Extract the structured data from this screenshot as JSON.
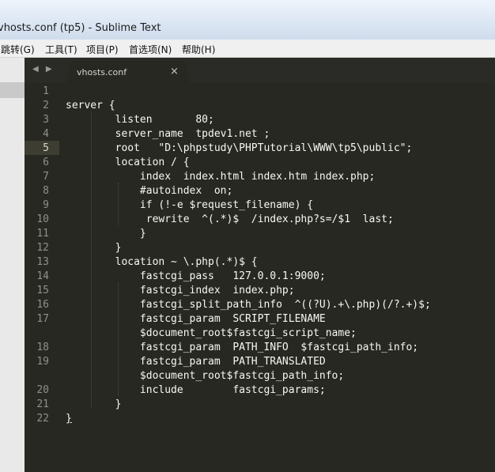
{
  "window": {
    "title": "vhosts.conf (tp5) - Sublime Text"
  },
  "menu": [
    {
      "label": "跳转(G)"
    },
    {
      "label": "工具(T)"
    },
    {
      "label": "项目(P)"
    },
    {
      "label": "首选项(N)"
    },
    {
      "label": "帮助(H)"
    }
  ],
  "tab": {
    "name": "vhosts.conf",
    "close": "×",
    "nav": "◀ ▶"
  },
  "editor": {
    "current_line": 5,
    "gutter": [
      "1",
      "2",
      "3",
      "4",
      "5",
      "6",
      "7",
      "8",
      "9",
      "10",
      "11",
      "12",
      "13",
      "14",
      "15",
      "16",
      "17",
      "",
      "18",
      "19",
      "",
      "20",
      "21",
      "22"
    ],
    "lines": [
      "",
      "server {",
      "        listen       80;",
      "        server_name  tpdev1.net ;",
      "        root   \"D:\\phpstudy\\PHPTutorial\\WWW\\tp5\\public\";",
      "        location / {",
      "            index  index.html index.htm index.php;",
      "            #autoindex  on;",
      "            if (!-e $request_filename) {",
      "             rewrite  ^(.*)$  /index.php?s=/$1  last;",
      "            }",
      "        }",
      "        location ~ \\.php(.*)$ {",
      "            fastcgi_pass   127.0.0.1:9000;",
      "            fastcgi_index  index.php;",
      "            fastcgi_split_path_info  ^((?U).+\\.php)(/?.+)$;",
      "            fastcgi_param  SCRIPT_FILENAME",
      "            $document_root$fastcgi_script_name;",
      "            fastcgi_param  PATH_INFO  $fastcgi_path_info;",
      "            fastcgi_param  PATH_TRANSLATED",
      "            $document_root$fastcgi_path_info;",
      "            include        fastcgi_params;",
      "        }",
      "}"
    ]
  },
  "colors": {
    "editor_bg": "#272822",
    "text": "#f8f8f2",
    "gutter_text": "#90908a",
    "current_line": "#3e3d32"
  }
}
